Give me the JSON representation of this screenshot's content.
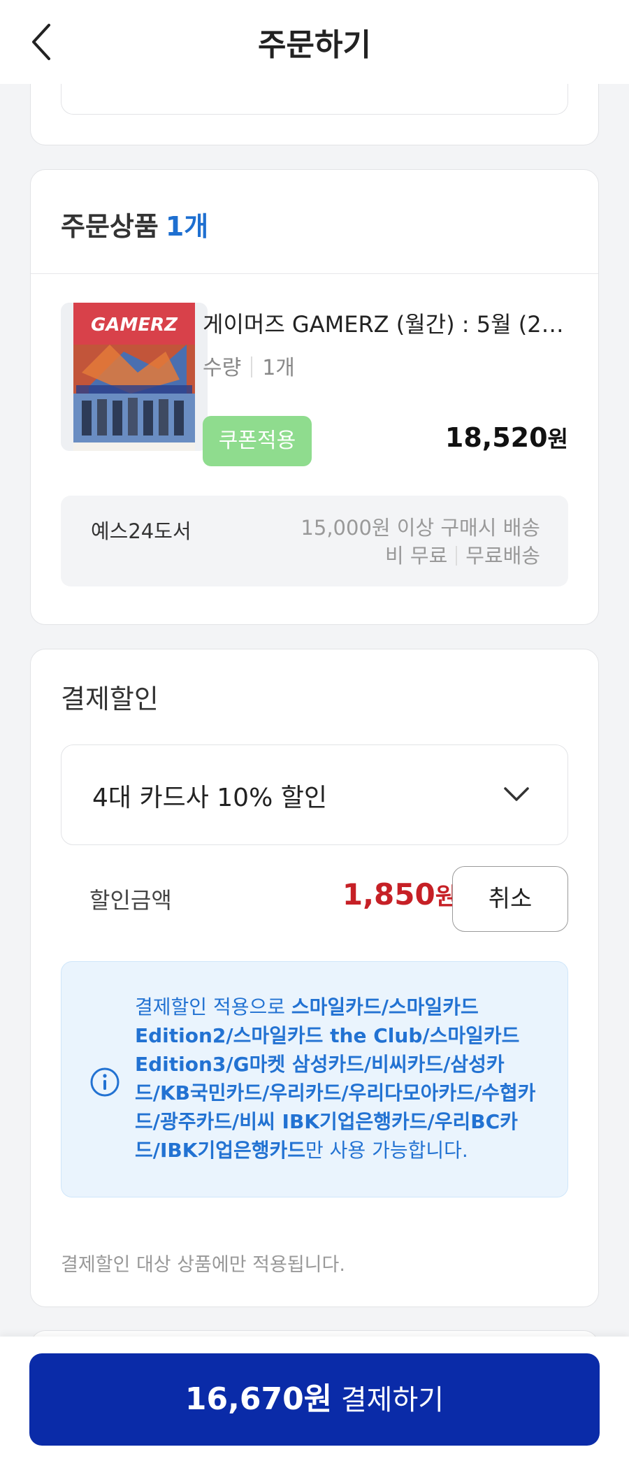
{
  "header": {
    "title": "주문하기"
  },
  "order_items": {
    "title": "주문상품",
    "count": "1개",
    "items": [
      {
        "name": "게이머즈 GAMERZ (월간) : 5월 (2…",
        "qty_label": "수량",
        "qty": "1개",
        "coupon_label": "쿠폰적용",
        "price": "18,520",
        "price_unit": "원",
        "thumb_text": "GAMERZ"
      }
    ],
    "seller": "예스24도서",
    "shipping_line1": "15,000원 이상 구매시 배송",
    "shipping_line2": "비 무료",
    "shipping_type": "무료배송"
  },
  "payment_discount": {
    "title": "결제할인",
    "selected": "4대 카드사 10% 할인",
    "amount_label": "할인금액",
    "amount": "1,850",
    "amount_unit": "원",
    "cancel_label": "취소",
    "notice": {
      "prefix": "결제할인 적용으로 ",
      "cards": "스마일카드/스마일카드 Edition2/스마일카드 the Club/스마일카드 Edition3/G마켓 삼성카드/비씨카드/삼성카드/KB국민카드/우리카드/우리다모아카드/수협카드/광주카드/비씨 IBK기업은행카드/우리BC카드/IBK기업은행카드",
      "suffix": "만 사용 가능합니다."
    },
    "footnote": "결제할인 대상 상품에만 적용됩니다."
  },
  "pay_button": {
    "amount": "16,670원",
    "label": " 결제하기"
  },
  "colors": {
    "accent_blue": "#1e6fd0",
    "pay_button": "#0a2ba8",
    "discount_red": "#c62026",
    "coupon_green": "#8fdc8e"
  }
}
